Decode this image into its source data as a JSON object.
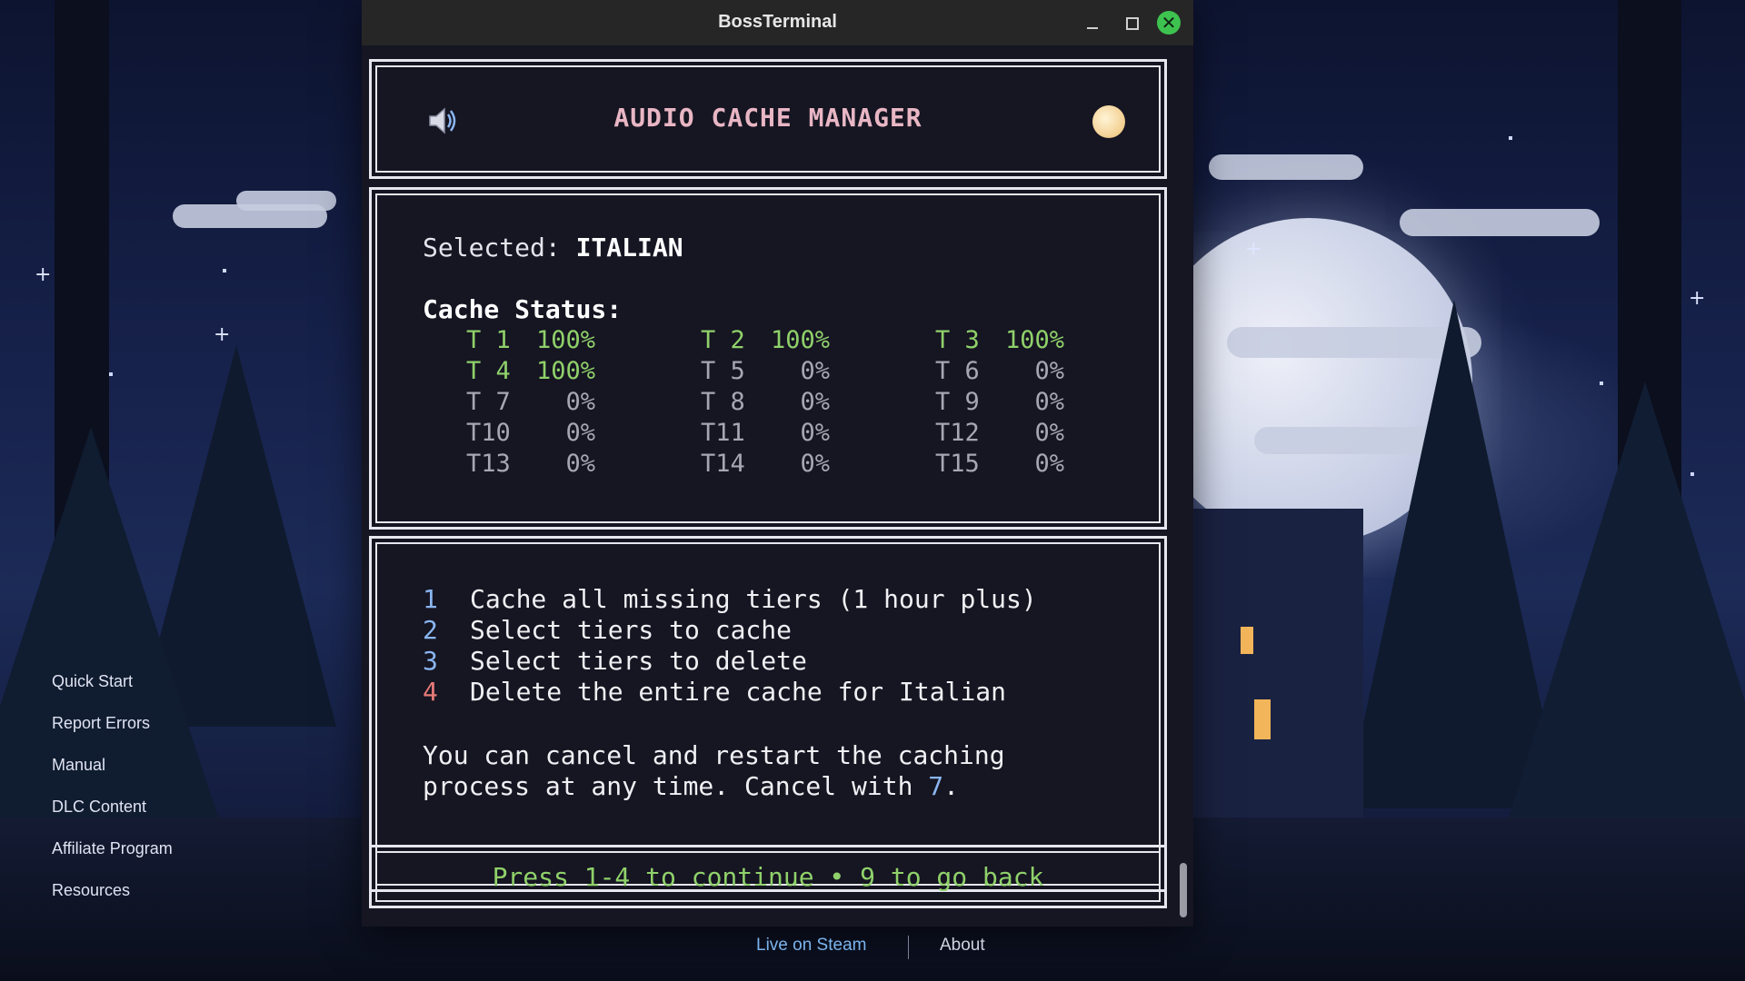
{
  "window": {
    "title": "BossTerminal",
    "close_glyph": "✕"
  },
  "header": {
    "title": "AUDIO CACHE MANAGER",
    "icon_left": "speaker-icon",
    "icon_right": "moon-icon"
  },
  "status": {
    "selected_label": "Selected:",
    "selected_value": "ITALIAN",
    "cache_label": "Cache Status:",
    "tiers": [
      {
        "name": "T 1",
        "pct": "100%"
      },
      {
        "name": "T 2",
        "pct": "100%"
      },
      {
        "name": "T 3",
        "pct": "100%"
      },
      {
        "name": "T 4",
        "pct": "100%"
      },
      {
        "name": "T 5",
        "pct": "0%"
      },
      {
        "name": "T 6",
        "pct": "0%"
      },
      {
        "name": "T 7",
        "pct": "0%"
      },
      {
        "name": "T 8",
        "pct": "0%"
      },
      {
        "name": "T 9",
        "pct": "0%"
      },
      {
        "name": "T10",
        "pct": "0%"
      },
      {
        "name": "T11",
        "pct": "0%"
      },
      {
        "name": "T12",
        "pct": "0%"
      },
      {
        "name": "T13",
        "pct": "0%"
      },
      {
        "name": "T14",
        "pct": "0%"
      },
      {
        "name": "T15",
        "pct": "0%"
      }
    ]
  },
  "menu": {
    "options": [
      {
        "key": "1",
        "label": "Cache all missing tiers (1 hour plus)"
      },
      {
        "key": "2",
        "label": "Select tiers to cache"
      },
      {
        "key": "3",
        "label": "Select tiers to delete"
      },
      {
        "key": "4",
        "label": "Delete the entire cache for Italian"
      }
    ],
    "note_line1": "You can cancel and restart the caching",
    "note_line2_prefix": "process at any time. Cancel with ",
    "note_key": "7",
    "note_suffix": "."
  },
  "footer": {
    "text": "Press 1-4 to continue • 9 to go back"
  },
  "sidebar": {
    "items": [
      {
        "label": "Quick Start"
      },
      {
        "label": "Report Errors"
      },
      {
        "label": "Manual"
      },
      {
        "label": "DLC Content"
      },
      {
        "label": "Affiliate Program"
      },
      {
        "label": "Resources"
      }
    ]
  },
  "bottom": {
    "steam_label": "Live on Steam",
    "about_label": "About"
  },
  "colors": {
    "accent_green": "#8fd16a",
    "accent_blue": "#8ab6f0",
    "accent_red": "#e77a78",
    "title_pink": "#e8b6c4"
  }
}
